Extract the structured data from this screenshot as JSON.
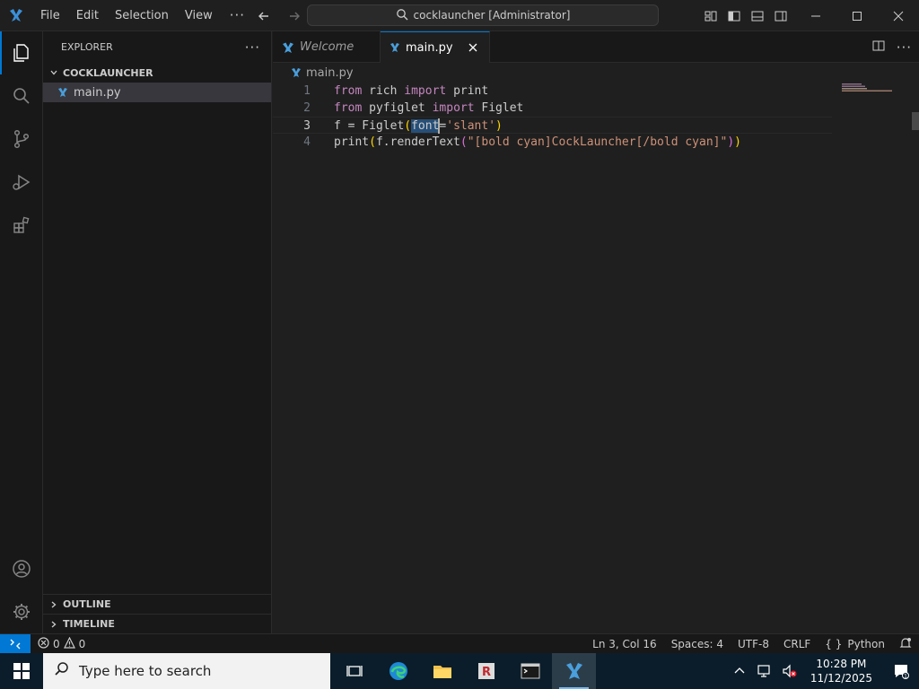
{
  "titlebar": {
    "menu": [
      "File",
      "Edit",
      "Selection",
      "View"
    ],
    "more": "···",
    "command_center": "cocklauncher [Administrator]"
  },
  "sidebar": {
    "title": "EXPLORER",
    "more": "···",
    "folder": "COCKLAUNCHER",
    "files": [
      "main.py"
    ],
    "outline": "OUTLINE",
    "timeline": "TIMELINE"
  },
  "tabs": [
    {
      "label": "Welcome"
    },
    {
      "label": "main.py",
      "close": "✕"
    }
  ],
  "breadcrumb": "main.py",
  "code": {
    "line_numbers": [
      "1",
      "2",
      "3",
      "4"
    ],
    "l1": {
      "a": "from",
      "b": " rich ",
      "c": "import",
      "d": " print"
    },
    "l2": {
      "a": "from",
      "b": " pyfiglet ",
      "c": "import",
      "d": " Figlet"
    },
    "l3": {
      "a": "f = Figlet",
      "b": "(",
      "c": "font",
      "d": "=",
      "e": "'slant'",
      "f": ")"
    },
    "l4": {
      "a": "print",
      "b": "(",
      "c": "f.renderText",
      "d": "(",
      "e": "\"[bold cyan]CockLauncher[/bold cyan]\"",
      "f": ")",
      "g": ")"
    }
  },
  "statusbar": {
    "errors": "0",
    "warnings": "0",
    "position": "Ln 3, Col 16",
    "spaces": "Spaces: 4",
    "encoding": "UTF-8",
    "eol": "CRLF",
    "language_braces": "{ }",
    "language": "Python"
  },
  "taskbar": {
    "search_placeholder": "Type here to search",
    "time": "10:28 PM",
    "date": "11/12/2025"
  },
  "colors": {
    "accent": "#0078d4",
    "keyword": "#c586c0",
    "string": "#ce9178",
    "bracket": "#ffd700"
  }
}
